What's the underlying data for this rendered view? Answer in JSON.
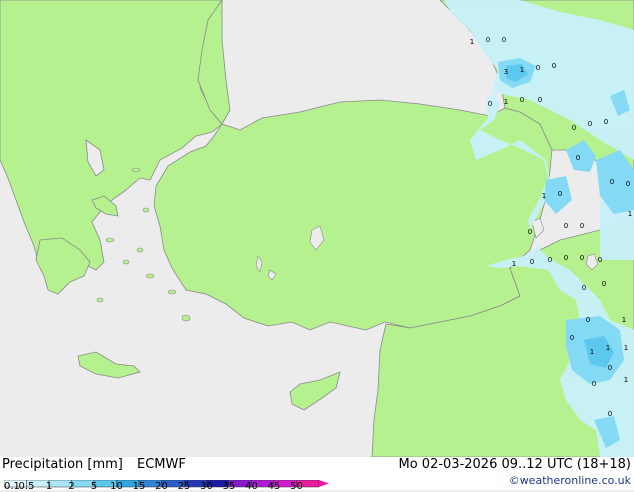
{
  "legend": {
    "title": "Precipitation [mm]",
    "model": "ECMWF",
    "ticks": [
      "0.1",
      "0.5",
      "1",
      "2",
      "5",
      "10",
      "15",
      "20",
      "25",
      "30",
      "35",
      "40",
      "45",
      "50"
    ],
    "colors": [
      "#e6f9ff",
      "#c8f0fb",
      "#a8e6f8",
      "#84d9f4",
      "#5cc8ee",
      "#2fa8e2",
      "#2f86d8",
      "#2c5fcc",
      "#2339b8",
      "#1c1aa4",
      "#8a1acc",
      "#b01ad6",
      "#d21acc",
      "#e81aa0"
    ]
  },
  "valid_time": "Mo 02-03-2026 09..12 UTC (18+18)",
  "credit": "©weatheronline.co.uk",
  "colors": {
    "land": "#b5f28f",
    "sea": "#ececec",
    "coast": "#8a8a8a",
    "precip_light": "#c8f0fb",
    "precip_medium": "#84d9f4",
    "precip_heavy": "#5cc8ee"
  },
  "map_labels": [
    "1",
    "0",
    "0",
    "3",
    "1",
    "0",
    "0",
    "0",
    "1",
    "0",
    "0",
    "0",
    "0",
    "0",
    "0",
    "0",
    "0",
    "0",
    "1",
    "1",
    "0",
    "0",
    "0",
    "0",
    "0",
    "1",
    "0",
    "0",
    "0",
    "0",
    "0",
    "0",
    "1",
    "0",
    "1",
    "1",
    "1",
    "0",
    "0",
    "0",
    "1"
  ]
}
